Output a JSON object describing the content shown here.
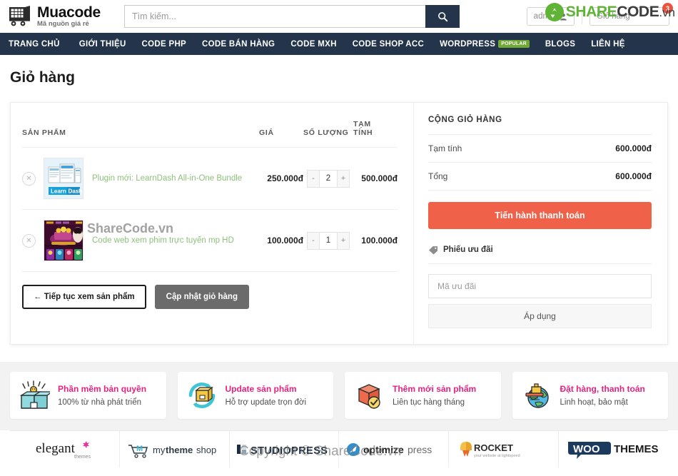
{
  "header": {
    "logo_name": "Muacode",
    "logo_tagline": "Mã nguồn giá rẻ",
    "logo_icon": "shopping-cart-icon",
    "search_placeholder": "Tìm kiếm...",
    "search_value": "",
    "search_icon": "search-icon",
    "account_label": "admin",
    "account_icon": "user-icon",
    "cart_label": "Giỏ hàng",
    "cart_badge": "3"
  },
  "watermark": {
    "brand_share": "SHARE",
    "brand_code": "CODE",
    "brand_vn": ".vn",
    "brand_icon": "recycle-icon",
    "mid_text": "ShareCode.vn",
    "bottom_text": "Copyright © ShareCode.vn"
  },
  "nav": {
    "items": [
      {
        "label": "TRANG CHỦ",
        "badge": ""
      },
      {
        "label": "GIỚI THIỆU",
        "badge": ""
      },
      {
        "label": "CODE PHP",
        "badge": ""
      },
      {
        "label": "CODE BÁN HÀNG",
        "badge": ""
      },
      {
        "label": "CODE MXH",
        "badge": ""
      },
      {
        "label": "CODE SHOP ACC",
        "badge": ""
      },
      {
        "label": "WORDPRESS",
        "badge": "POPULAR"
      },
      {
        "label": "BLOGS",
        "badge": ""
      },
      {
        "label": "LIÊN HỆ",
        "badge": ""
      }
    ]
  },
  "page": {
    "title": "Giỏ hàng"
  },
  "cart": {
    "columns": {
      "product": "SẢN PHẨM",
      "price": "GIÁ",
      "quantity": "SỐ LƯỢNG",
      "subtotal_line1": "TẠM",
      "subtotal_line2": "TÍNH"
    },
    "rows": [
      {
        "remove_icon": "remove-item-icon",
        "thumbnail": "learndash-product-thumbnail",
        "name": "Plugin mới: LearnDash All-in-One Bundle",
        "price": "250.000đ",
        "qty_minus": "-",
        "qty": "2",
        "qty_plus": "+",
        "subtotal": "500.000đ"
      },
      {
        "remove_icon": "remove-item-icon",
        "thumbnail": "game-product-thumbnail",
        "name": "Code web xem phim trực tuyến mp HD",
        "price": "100.000đ",
        "qty_minus": "-",
        "qty": "1",
        "qty_plus": "+",
        "subtotal": "100.000đ"
      }
    ],
    "continue_label": "← Tiếp tục xem sản phẩm",
    "update_label": "Cập nhật giỏ hàng"
  },
  "totals": {
    "title": "CỘNG GIỎ HÀNG",
    "rows": [
      {
        "label": "Tạm tính",
        "value": "600.000đ"
      },
      {
        "label": "Tổng",
        "value": "600.000đ"
      }
    ],
    "checkout_label": "Tiến hành thanh toán"
  },
  "coupon": {
    "icon": "tag-icon",
    "title": "Phiếu ưu đãi",
    "input_placeholder": "Mã ưu đãi",
    "input_value": "",
    "apply_label": "Áp dụng"
  },
  "features": [
    {
      "icon": "gift-box-icon",
      "title": "Phần mềm bản quyền",
      "subtitle": "100% từ nhà phát triển"
    },
    {
      "icon": "update-package-icon",
      "title": "Update sản phẩm",
      "subtitle": "Hỗ trợ update trọn đời"
    },
    {
      "icon": "new-product-check-icon",
      "title": "Thêm mới sản phẩm",
      "subtitle": "Liên tục hàng tháng"
    },
    {
      "icon": "globe-delivery-icon",
      "title": "Đặt hàng, thanh toán",
      "subtitle": "Linh hoạt, bảo mật"
    }
  ],
  "partners": [
    {
      "name": "elegant",
      "sub": "themes"
    },
    {
      "name": "mythemeshop",
      "sub": ""
    },
    {
      "name": "STUDIOPRESS",
      "sub": ""
    },
    {
      "name": "optimizepress",
      "sub": ""
    },
    {
      "name": "WP ROCKET",
      "sub": "your website at lightspeed"
    },
    {
      "name": "WOO",
      "sub": "THEMES"
    }
  ],
  "colors": {
    "nav_bg": "#24344a",
    "accent_orange": "#f0614a",
    "accent_pink": "#e6217f",
    "brand_green": "#5fb336",
    "product_link": "#8ec07c"
  }
}
